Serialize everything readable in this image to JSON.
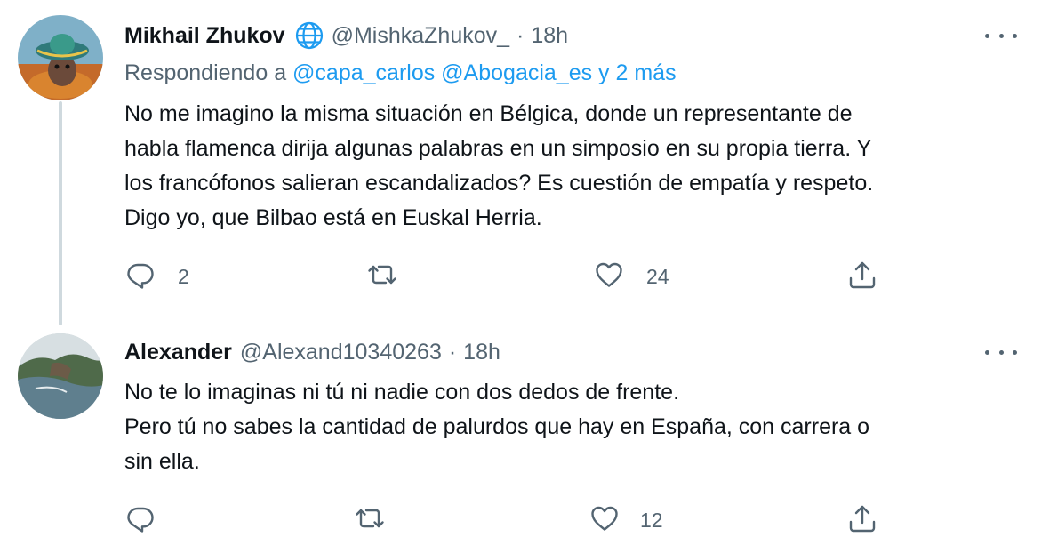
{
  "tweets": [
    {
      "name": "Mikhail Zhukov",
      "handle": "@MishkaZhukov_",
      "separator": "·",
      "time": "18h",
      "verified_badge_icon": "globe-icon",
      "replying_prefix": "Respondiendo a",
      "replying_mentions": "@capa_carlos @Abogacia_es y 2 más",
      "text_lines": [
        "No me imagino la misma situación en Bélgica, donde un representante de",
        "habla flamenca dirija algunas palabras en un simposio en su propia tierra. Y",
        "los francófonos salieran escandalizados? Es cuestión de empatía y respeto.",
        "Digo yo, que Bilbao está en Euskal Herria."
      ],
      "reply_count": "2",
      "retweet_count": "",
      "like_count": "24"
    },
    {
      "name": "Alexander",
      "handle": "@Alexand10340263",
      "separator": "·",
      "time": "18h",
      "text_lines": [
        "No te lo imaginas ni tú ni nadie con dos dedos de frente.",
        "Pero tú no sabes la cantidad de palurdos que hay en España, con carrera o",
        "sin ella."
      ],
      "reply_count": "",
      "retweet_count": "",
      "like_count": "12"
    }
  ],
  "colors": {
    "text": "#0f1419",
    "muted": "#536471",
    "link": "#1d9bf0",
    "thread_line": "#cfd9de"
  },
  "icons": [
    "reply-icon",
    "retweet-icon",
    "like-icon",
    "share-icon",
    "more-icon"
  ]
}
